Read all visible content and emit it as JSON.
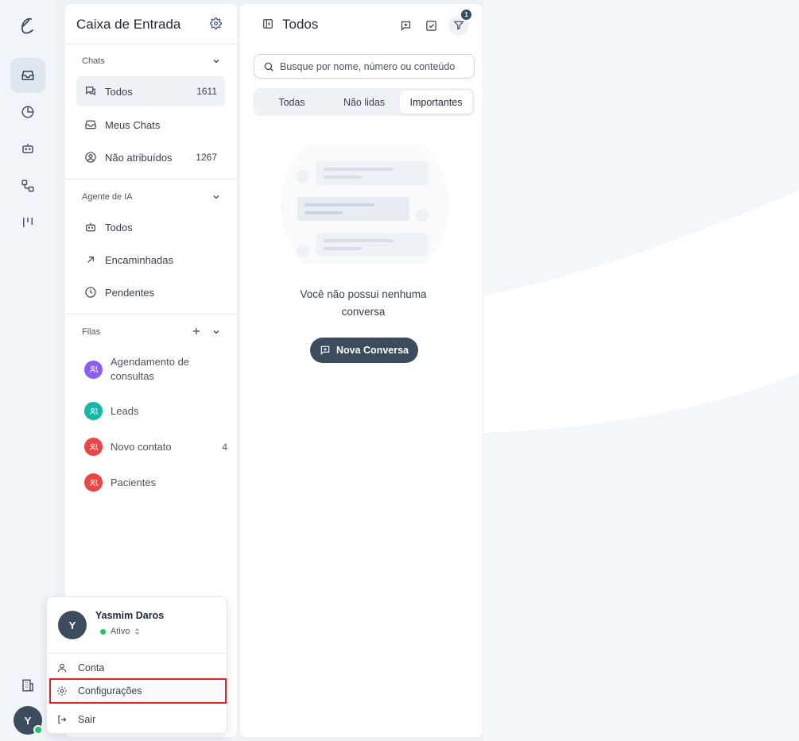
{
  "inbox": {
    "title": "Caixa de Entrada",
    "sections": {
      "chats": {
        "label": "Chats",
        "items": [
          {
            "label": "Todos",
            "count": "1611",
            "icon": "chats-icon"
          },
          {
            "label": "Meus Chats",
            "count": "",
            "icon": "inbox-icon"
          },
          {
            "label": "Não atribuídos",
            "count": "1267",
            "icon": "user-circle-icon"
          }
        ]
      },
      "ai_agent": {
        "label": "Agente de IA",
        "items": [
          {
            "label": "Todos",
            "icon": "bot-icon"
          },
          {
            "label": "Encaminhadas",
            "icon": "arrow-up-right-icon"
          },
          {
            "label": "Pendentes",
            "icon": "clock-icon"
          }
        ]
      },
      "queues": {
        "label": "Filas",
        "items": [
          {
            "label": "Agendamento de consultas",
            "count": "",
            "color": "#8b5cf6"
          },
          {
            "label": "Leads",
            "count": "",
            "color": "#14b8a6"
          },
          {
            "label": "Novo contato",
            "count": "4",
            "color": "#ef4444"
          },
          {
            "label": "Pacientes",
            "count": "",
            "color": "#ef4444"
          }
        ]
      }
    }
  },
  "conversations": {
    "title": "Todos",
    "filter_badge": "1",
    "search_placeholder": "Busque por nome, número ou conteúdo",
    "tabs": [
      {
        "label": "Todas",
        "active": false
      },
      {
        "label": "Não lidas",
        "active": false
      },
      {
        "label": "Importantes",
        "active": true
      }
    ],
    "empty_text": "Você não possui nenhuma conversa",
    "new_conversation_label": "Nova Conversa"
  },
  "user": {
    "initial": "Y",
    "name": "Yasmim Daros",
    "status": "Ativo",
    "status_color": "#22c55e",
    "menu": [
      {
        "label": "Conta",
        "icon": "user-icon"
      },
      {
        "label": "Configurações",
        "icon": "gear-icon",
        "highlighted": true
      },
      {
        "label": "Sair",
        "icon": "logout-icon"
      }
    ]
  },
  "colors": {
    "primary": "#3b4d5c",
    "highlight_border": "#dc2626",
    "background": "#eef2f7"
  }
}
